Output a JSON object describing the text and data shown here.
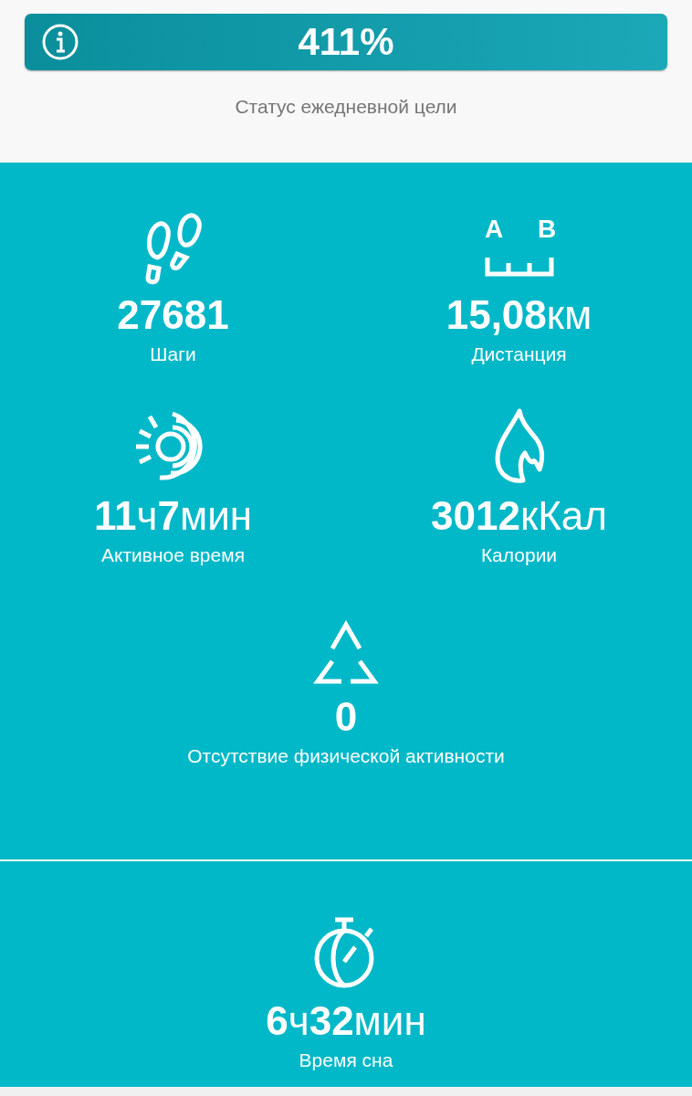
{
  "goal": {
    "percent": "411%",
    "caption": "Статус ежедневной цели"
  },
  "metrics": [
    {
      "kind": "steps",
      "value": "**27681**",
      "label": "Шаги"
    },
    {
      "kind": "distance",
      "icon_letters": [
        "A",
        "B"
      ],
      "value": "**15,08**км",
      "label": "Дистанция"
    },
    {
      "kind": "active",
      "value": "**11**ч**7**мин",
      "label": "Активное время"
    },
    {
      "kind": "calories",
      "value": "**3012**кКал",
      "label": "Калории"
    },
    {
      "kind": "inactivity",
      "value": "**0**",
      "label": "Отсутствие физической активности"
    }
  ],
  "sleep": {
    "value": "**6**ч**32**мин",
    "label": "Время сна"
  }
}
